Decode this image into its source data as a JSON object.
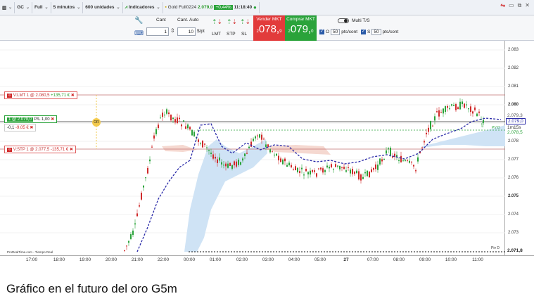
{
  "topbar": {
    "symbol": "GC",
    "chart_type": "Full",
    "timeframe": "5 minutos",
    "units": "600 unidades",
    "indicators": "Indicadores",
    "instrument": "Gold Full0224",
    "price": "2.079,0",
    "change": "+0,44%",
    "time": "11:18:40"
  },
  "ordertoolbar": {
    "qty_label": "Cant",
    "qty_auto_label": "Cant. Auto",
    "qty_value": "1",
    "qty_auto_value": "10",
    "qty_unit": "$/pt",
    "lmt": "LMT",
    "stp": "STP",
    "sl": "SL",
    "sell_label": "Vender MKT",
    "sell_price": "2.078,",
    "sell_price_big": "078,",
    "sell_price_small": "2",
    "sell_price_tail": "9",
    "buy_label": "Comprar MKT",
    "buy_price_small": "2",
    "buy_price_big": "079,",
    "buy_price_tail": "0",
    "multi_label": "Multi T/S",
    "o_label": "O",
    "o_value": "50",
    "o_unit": "pts/cont",
    "s_label": "S",
    "s_value": "50",
    "s_unit": "pts/cont"
  },
  "orders": {
    "limit": "V:LMT  1  @  2.080,5",
    "limit_pnl": "+135,71 €",
    "position": "1  @  2.079,0",
    "position_pl": "P/L  1,00",
    "position_sub": "-0,1",
    "position_eur": "-9,05 €",
    "stop": "V:STP  1  @  2.077,5",
    "stop_pnl": "-135,71 €",
    "or_badge": "OR"
  },
  "price_axis": {
    "ticks": [
      "2.083",
      "2.082",
      "2.081",
      "2.080",
      "2.079",
      "2.078",
      "2.077",
      "2.076",
      "2.075",
      "2.074",
      "2.073"
    ],
    "badge_current": "2.079,0",
    "badge_sell": "2.078,5",
    "badge_timer": "1m15s",
    "badge_low": "2.071,8",
    "badge_upper": "2.079,3",
    "piv_label": "Piv D",
    "pvd_label": "PV D"
  },
  "time_axis": {
    "labels": [
      "17:00",
      "18:00",
      "19:00",
      "20:00",
      "21:00",
      "22:00",
      "00:00",
      "01:00",
      "02:00",
      "03:00",
      "04:00",
      "05:00",
      "27",
      "07:00",
      "08:00",
      "09:00",
      "10:00",
      "11:00"
    ]
  },
  "footer_left": "ProRealTime.com - Tiempo Real",
  "caption": "Gráfico en el futuro del oro G5m",
  "colors": {
    "up": "#2aa33a",
    "down": "#d02a2a",
    "ma": "#2a2aa8",
    "cloud": "#cfe3f5",
    "cloud_red": "#f5d8d0"
  }
}
